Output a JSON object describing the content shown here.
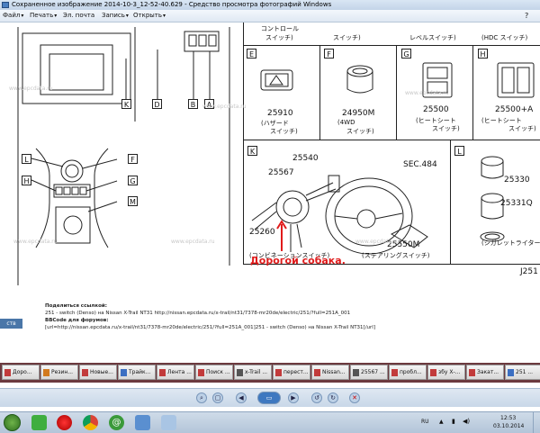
{
  "window": {
    "title": "Сохраненное изображение 2014-10-3_12-52-40.629 - Средство просмотра фотографий Windows"
  },
  "menu": {
    "items": [
      {
        "label": "Файл"
      },
      {
        "label": "Печать"
      },
      {
        "label": "Эл. почта"
      },
      {
        "label": "Запись"
      },
      {
        "label": "Открыть"
      }
    ]
  },
  "diagram": {
    "top_captions": [
      "コントロール",
      "スイッチ)",
      "スイッチ)",
      "レベルスイッチ)",
      "(HDC スイッチ)"
    ],
    "left_labels": [
      "K",
      "D",
      "B",
      "A",
      "L",
      "F",
      "H",
      "G",
      "M"
    ],
    "panels": [
      {
        "letter": "E",
        "part": "25910",
        "caption1": "(ハザード",
        "caption2": "スイッチ)"
      },
      {
        "letter": "F",
        "part": "24950M",
        "caption1": "(4WD",
        "caption2": "スイッチ)"
      },
      {
        "letter": "G",
        "part": "25500",
        "caption1": "(ヒートシート",
        "caption2": "スイッチ)"
      },
      {
        "letter": "H",
        "part": "25500+A",
        "caption1": "(ヒートシート",
        "caption2": "スイッチ)"
      }
    ],
    "panel_k": {
      "letter": "K",
      "parts": [
        "25540",
        "25567",
        "25260",
        "SEC.484",
        "25550M"
      ],
      "caption_left": "(コンビネーションスイッチ)",
      "caption_right": "(ステアリングスイッチ)",
      "annotation": "Дорогой собака."
    },
    "panel_l": {
      "letter": "L",
      "parts": [
        "25330",
        "25331Q"
      ],
      "caption": "(シガレットライター)"
    },
    "page_code": "J251",
    "watermark": "www.epcdata.ru"
  },
  "info": {
    "share_heading": "Поделиться ссылкой:",
    "share_text": "251 - switch (Denso) на Nissan X-Trail NT31 http://nissan.epcdata.ru/x-trail/nt31/7378-mr20de/electric/251/?full=251A_001",
    "forum_heading": "BBCode для форумов:",
    "forum_text": "[url=http://nissan.epcdata.ru/x-trail/nt31/7378-mr20de/electric/251/?full=251A_001]251 - switch (Denso) на Nissan X-Trail NT31[/url]",
    "side_badge": "ств"
  },
  "tabs": [
    {
      "label": "Доро...",
      "color": "#c23b3b"
    },
    {
      "label": "Резин...",
      "color": "#d27a1e"
    },
    {
      "label": "Новые...",
      "color": "#c23b3b"
    },
    {
      "label": "Трайк...",
      "color": "#3b6fc2"
    },
    {
      "label": "Лента ...",
      "color": "#c23b3b"
    },
    {
      "label": "Поиск ...",
      "color": "#c23b3b"
    },
    {
      "label": "x-Trail ...",
      "color": "#555555"
    },
    {
      "label": "перест...",
      "color": "#c23b3b"
    },
    {
      "label": "Nissan...",
      "color": "#c23b3b"
    },
    {
      "label": "25567 ...",
      "color": "#555555"
    },
    {
      "label": "пробл...",
      "color": "#c23b3b"
    },
    {
      "label": "збу Х-...",
      "color": "#c23b3b"
    },
    {
      "label": "Закат...",
      "color": "#c23b3b"
    },
    {
      "label": "251 ...",
      "color": "#3b6fc2"
    }
  ],
  "tray": {
    "lang": "RU",
    "time": "12:53",
    "date": "03.10.2014"
  }
}
